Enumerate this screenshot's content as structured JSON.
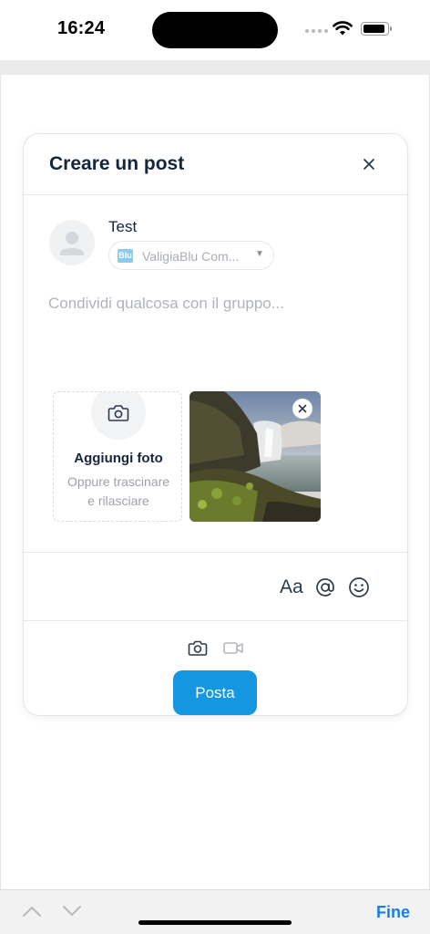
{
  "status_bar": {
    "time": "16:24",
    "battery_level": 0.9
  },
  "modal": {
    "title": "Creare un post",
    "user": {
      "name": "Test"
    },
    "group_select": {
      "logo_text": "Blu",
      "selected": "ValigiaBlu Com..."
    },
    "composer": {
      "placeholder": "Condividi qualcosa con il gruppo..."
    },
    "add_photo": {
      "title": "Aggiungi foto",
      "subtitle": "Oppure trascinare e rilasciare"
    },
    "format_tools": {
      "text": "Aa"
    },
    "post_button": "Posta",
    "colors": {
      "accent": "#1496e0",
      "title": "#14263d"
    }
  },
  "bottom_bar": {
    "done_label": "Fine"
  }
}
